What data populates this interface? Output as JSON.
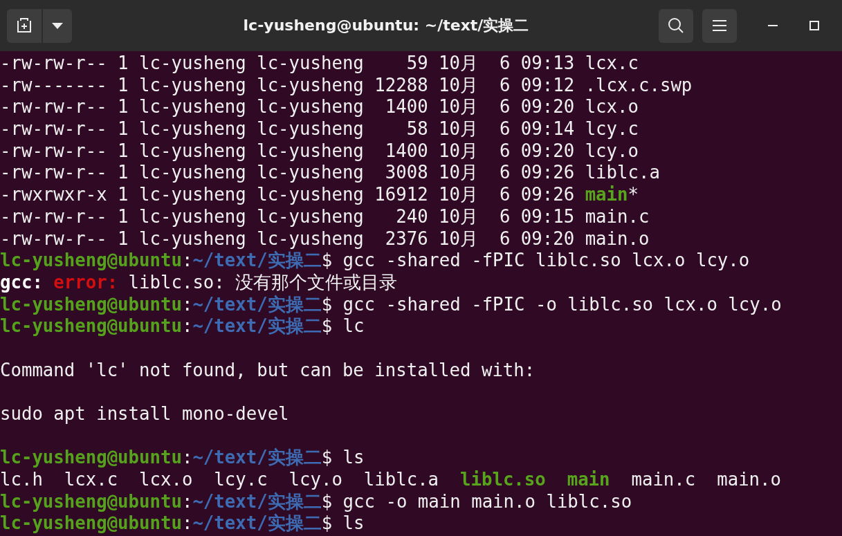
{
  "window": {
    "title": "lc-yusheng@ubuntu: ~/text/实操二"
  },
  "terminal": {
    "lines": [
      {
        "kind": "output",
        "segments": [
          {
            "kind": "plain",
            "text": "-rw-rw-r-- 1 lc-yusheng lc-yusheng    59 10月  6 09:13 lcx.c"
          }
        ]
      },
      {
        "kind": "output",
        "segments": [
          {
            "kind": "plain",
            "text": "-rw------- 1 lc-yusheng lc-yusheng 12288 10月  6 09:12 .lcx.c.swp"
          }
        ]
      },
      {
        "kind": "output",
        "segments": [
          {
            "kind": "plain",
            "text": "-rw-rw-r-- 1 lc-yusheng lc-yusheng  1400 10月  6 09:20 lcx.o"
          }
        ]
      },
      {
        "kind": "output",
        "segments": [
          {
            "kind": "plain",
            "text": "-rw-rw-r-- 1 lc-yusheng lc-yusheng    58 10月  6 09:14 lcy.c"
          }
        ]
      },
      {
        "kind": "output",
        "segments": [
          {
            "kind": "plain",
            "text": "-rw-rw-r-- 1 lc-yusheng lc-yusheng  1400 10月  6 09:20 lcy.o"
          }
        ]
      },
      {
        "kind": "output",
        "segments": [
          {
            "kind": "plain",
            "text": "-rw-rw-r-- 1 lc-yusheng lc-yusheng  3008 10月  6 09:26 liblc.a"
          }
        ]
      },
      {
        "kind": "output",
        "segments": [
          {
            "kind": "plain",
            "text": "-rwxrwxr-x 1 lc-yusheng lc-yusheng 16912 10月  6 09:26 "
          },
          {
            "kind": "exec",
            "text": "main"
          },
          {
            "kind": "plain",
            "text": "*"
          }
        ]
      },
      {
        "kind": "output",
        "segments": [
          {
            "kind": "plain",
            "text": "-rw-rw-r-- 1 lc-yusheng lc-yusheng   240 10月  6 09:15 main.c"
          }
        ]
      },
      {
        "kind": "output",
        "segments": [
          {
            "kind": "plain",
            "text": "-rw-rw-r-- 1 lc-yusheng lc-yusheng  2376 10月  6 09:20 main.o"
          }
        ]
      },
      {
        "kind": "output",
        "segments": [
          {
            "kind": "user",
            "text": "lc-yusheng@ubuntu"
          },
          {
            "kind": "plain",
            "text": ":"
          },
          {
            "kind": "path",
            "text": "~/text/实操二"
          },
          {
            "kind": "plain",
            "text": "$ gcc -shared -fPIC liblc.so lcx.o lcy.o"
          }
        ]
      },
      {
        "kind": "output",
        "segments": [
          {
            "kind": "bold",
            "text": "gcc: "
          },
          {
            "kind": "error",
            "text": "error: "
          },
          {
            "kind": "plain",
            "text": "liblc.so: 没有那个文件或目录"
          }
        ]
      },
      {
        "kind": "output",
        "segments": [
          {
            "kind": "user",
            "text": "lc-yusheng@ubuntu"
          },
          {
            "kind": "plain",
            "text": ":"
          },
          {
            "kind": "path",
            "text": "~/text/实操二"
          },
          {
            "kind": "plain",
            "text": "$ gcc -shared -fPIC -o liblc.so lcx.o lcy.o"
          }
        ]
      },
      {
        "kind": "output",
        "segments": [
          {
            "kind": "user",
            "text": "lc-yusheng@ubuntu"
          },
          {
            "kind": "plain",
            "text": ":"
          },
          {
            "kind": "path",
            "text": "~/text/实操二"
          },
          {
            "kind": "plain",
            "text": "$ lc"
          }
        ]
      },
      {
        "kind": "blank"
      },
      {
        "kind": "output",
        "segments": [
          {
            "kind": "plain",
            "text": "Command 'lc' not found, but can be installed with:"
          }
        ]
      },
      {
        "kind": "blank"
      },
      {
        "kind": "output",
        "segments": [
          {
            "kind": "plain",
            "text": "sudo apt install mono-devel"
          }
        ]
      },
      {
        "kind": "blank"
      },
      {
        "kind": "output",
        "segments": [
          {
            "kind": "user",
            "text": "lc-yusheng@ubuntu"
          },
          {
            "kind": "plain",
            "text": ":"
          },
          {
            "kind": "path",
            "text": "~/text/实操二"
          },
          {
            "kind": "plain",
            "text": "$ ls"
          }
        ]
      },
      {
        "kind": "output",
        "segments": [
          {
            "kind": "plain",
            "text": "lc.h  lcx.c  lcx.o  lcy.c  lcy.o  liblc.a  "
          },
          {
            "kind": "exec",
            "text": "liblc.so"
          },
          {
            "kind": "exec",
            "text": "  main"
          },
          {
            "kind": "plain",
            "text": "  main.c  main.o"
          }
        ]
      },
      {
        "kind": "output",
        "segments": [
          {
            "kind": "user",
            "text": "lc-yusheng@ubuntu"
          },
          {
            "kind": "plain",
            "text": ":"
          },
          {
            "kind": "path",
            "text": "~/text/实操二"
          },
          {
            "kind": "plain",
            "text": "$ gcc -o main main.o liblc.so"
          }
        ]
      },
      {
        "kind": "output",
        "segments": [
          {
            "kind": "user",
            "text": "lc-yusheng@ubuntu"
          },
          {
            "kind": "plain",
            "text": ":"
          },
          {
            "kind": "path",
            "text": "~/text/实操二"
          },
          {
            "kind": "plain",
            "text": "$ ls"
          }
        ]
      }
    ]
  }
}
